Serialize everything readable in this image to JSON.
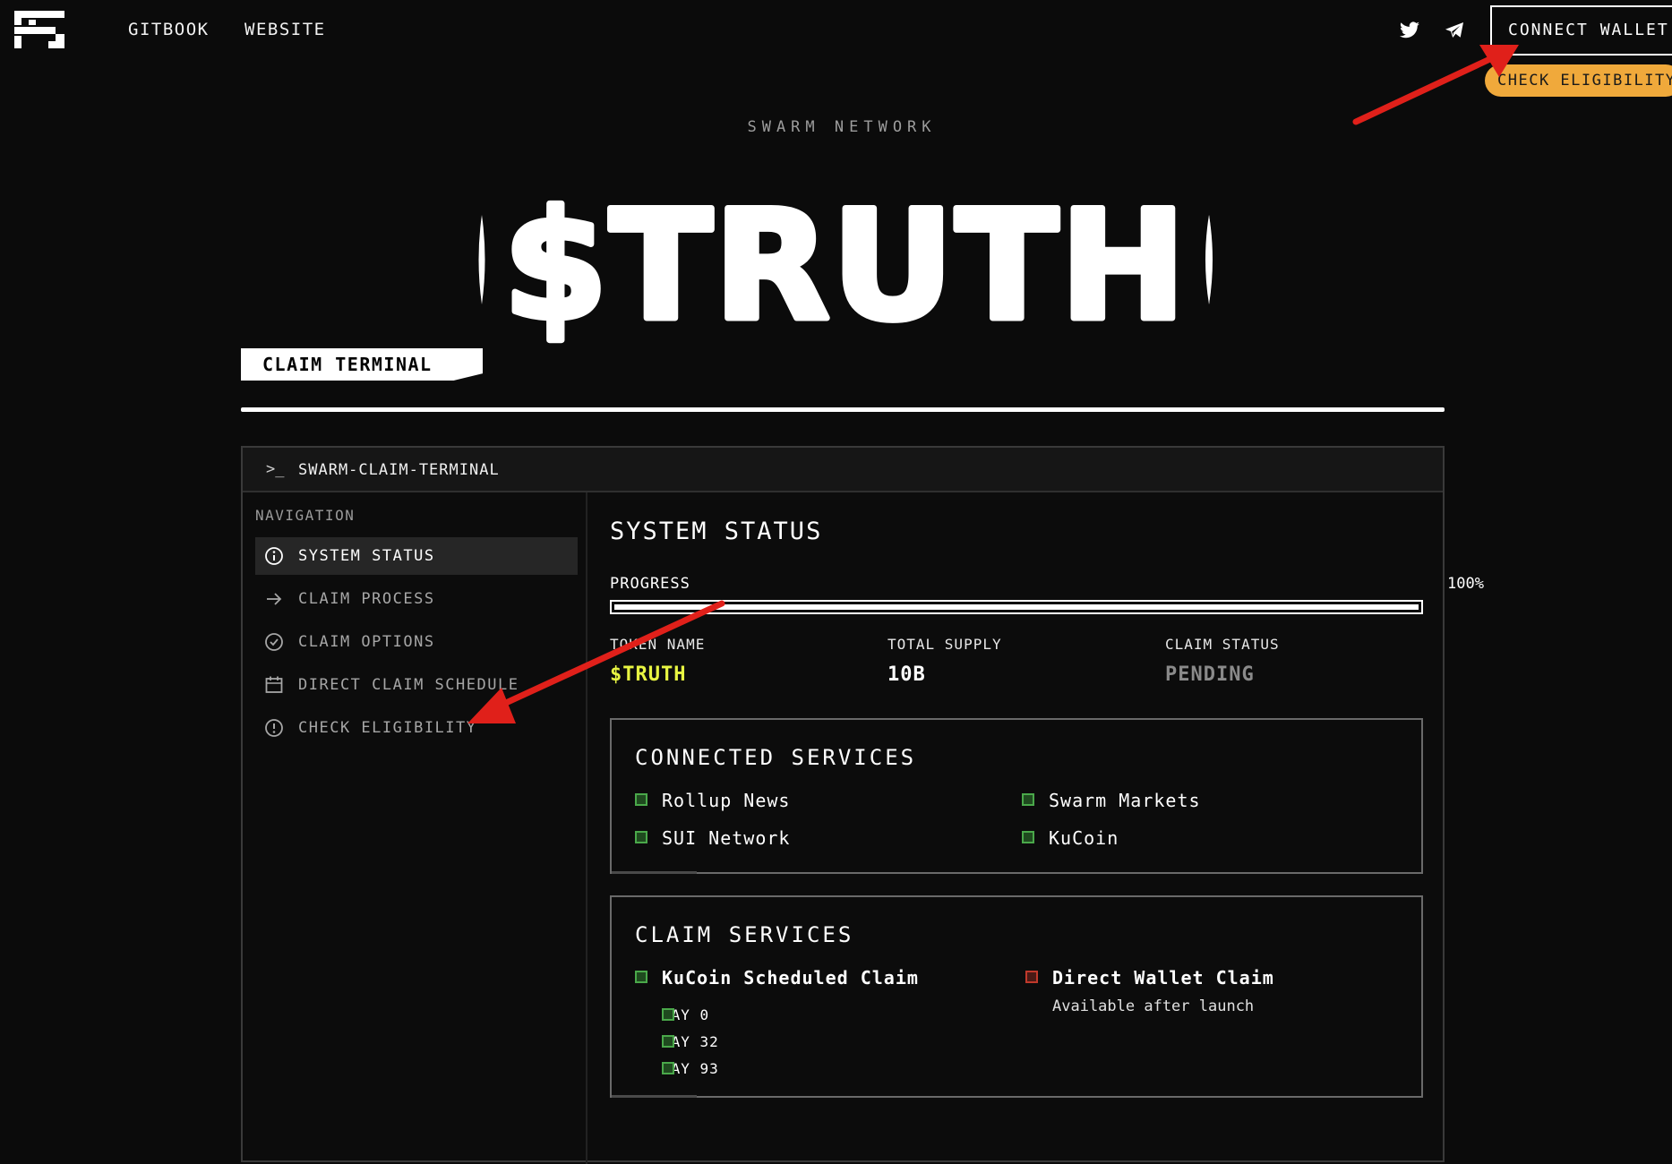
{
  "header": {
    "nav": [
      "GITBOOK",
      "WEBSITE"
    ],
    "connect_wallet": "CONNECT WALLET",
    "check_eligibility_badge": "CHECK ELIGIBILITY",
    "social_icons": [
      "twitter-icon",
      "telegram-icon"
    ]
  },
  "hero": {
    "eyebrow": "SWARM NETWORK",
    "title": "$TRUTH"
  },
  "tab": {
    "label": "CLAIM TERMINAL"
  },
  "terminal": {
    "prompt": ">_",
    "title": "SWARM-CLAIM-TERMINAL",
    "navigation": {
      "heading": "NAVIGATION",
      "items": [
        {
          "label": "SYSTEM STATUS",
          "icon": "info-icon",
          "active": true
        },
        {
          "label": "CLAIM PROCESS",
          "icon": "arrow-right-icon",
          "active": false
        },
        {
          "label": "CLAIM OPTIONS",
          "icon": "check-circle-icon",
          "active": false
        },
        {
          "label": "DIRECT CLAIM SCHEDULE",
          "icon": "calendar-icon",
          "active": false
        },
        {
          "label": "CHECK ELIGIBILITY",
          "icon": "alert-circle-icon",
          "active": false
        }
      ]
    },
    "system_status": {
      "heading": "SYSTEM STATUS",
      "progress_label": "PROGRESS",
      "progress_value": "100%",
      "progress_fraction": 1.0,
      "stats": [
        {
          "label": "TOKEN NAME",
          "value": "$TRUTH",
          "color": "#e8f542"
        },
        {
          "label": "TOTAL SUPPLY",
          "value": "10B",
          "color": "#ffffff"
        },
        {
          "label": "CLAIM STATUS",
          "value": "PENDING",
          "color": "#8a8a8a"
        }
      ]
    },
    "connected_services": {
      "heading": "CONNECTED SERVICES",
      "items": [
        "Rollup News",
        "Swarm Markets",
        "SUI Network",
        "KuCoin"
      ]
    },
    "claim_services": {
      "heading": "CLAIM SERVICES",
      "kucoin": {
        "label": "KuCoin Scheduled Claim",
        "days": [
          "DAY 0",
          "DAY 32",
          "DAY 93"
        ]
      },
      "direct": {
        "label": "Direct Wallet Claim",
        "note": "Available after launch"
      }
    }
  },
  "colors": {
    "background": "#0b0b0b",
    "accent_yellow": "#e8f542",
    "badge_orange": "#f0a93b",
    "status_green": "#4aa84a",
    "status_red": "#c0392b",
    "annotation_red": "#e0201a"
  }
}
